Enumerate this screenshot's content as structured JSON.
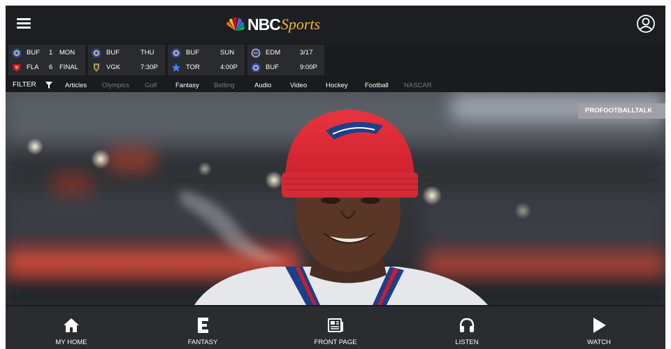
{
  "header": {
    "logo_main": "NBC",
    "logo_script": "Sports"
  },
  "scores": [
    {
      "team1": "BUF",
      "score1": "1",
      "status1": "MON",
      "team2": "FLA",
      "score2": "6",
      "status2": "FINAL"
    },
    {
      "team1": "BUF",
      "score1": "",
      "status1": "THU",
      "team2": "VGK",
      "score2": "",
      "status2": "7:30P"
    },
    {
      "team1": "BUF",
      "score1": "",
      "status1": "SUN",
      "team2": "TOR",
      "score2": "",
      "status2": "4:00P"
    },
    {
      "team1": "EDM",
      "score1": "",
      "status1": "3/17",
      "team2": "BUF",
      "score2": "",
      "status2": "9:00P"
    }
  ],
  "filter": {
    "label": "FILTER",
    "items": [
      "Articles",
      "Olympics",
      "Golf",
      "Fantasy",
      "Betting",
      "Audio",
      "Video",
      "Hockey",
      "Football",
      "NASCAR"
    ]
  },
  "hero": {
    "badge": "PROFOOTBALLTALK"
  },
  "bottom_nav": {
    "items": [
      "MY HOME",
      "FANTASY",
      "FRONT PAGE",
      "LISTEN",
      "WATCH"
    ]
  }
}
